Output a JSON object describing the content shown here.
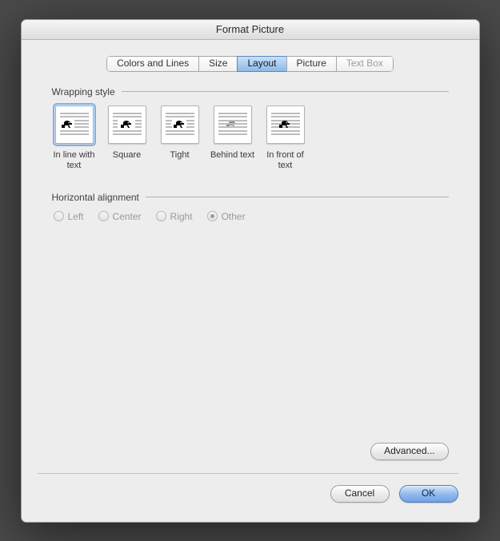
{
  "title": "Format Picture",
  "tabs": {
    "colors": "Colors and Lines",
    "size": "Size",
    "layout": "Layout",
    "picture": "Picture",
    "textbox": "Text Box",
    "selected": "layout",
    "disabled": [
      "textbox"
    ]
  },
  "groups": {
    "wrapping": {
      "title": "Wrapping style",
      "options": {
        "inline": {
          "label": "In line with text"
        },
        "square": {
          "label": "Square"
        },
        "tight": {
          "label": "Tight"
        },
        "behind": {
          "label": "Behind text"
        },
        "front": {
          "label": "In front of text"
        }
      },
      "selected": "inline"
    },
    "alignment": {
      "title": "Horizontal alignment",
      "options": {
        "left": "Left",
        "center": "Center",
        "right": "Right",
        "other": "Other"
      },
      "selected": "other",
      "enabled": false
    }
  },
  "buttons": {
    "advanced": "Advanced...",
    "cancel": "Cancel",
    "ok": "OK"
  }
}
